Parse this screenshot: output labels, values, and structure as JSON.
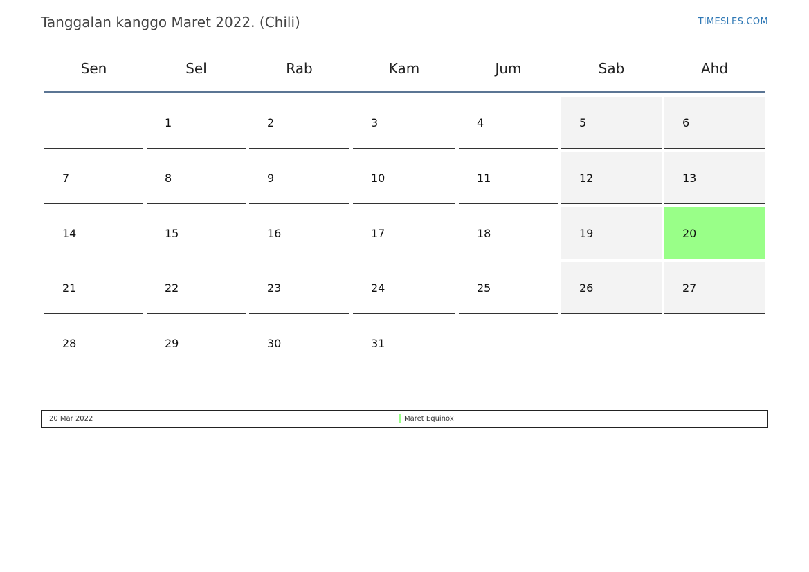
{
  "header": {
    "title": "Tanggalan kanggo Maret 2022. (Chili)",
    "site": "TIMESLES.COM"
  },
  "weekdays": [
    "Sen",
    "Sel",
    "Rab",
    "Kam",
    "Jum",
    "Sab",
    "Ahd"
  ],
  "weeks": [
    [
      "",
      "1",
      "2",
      "3",
      "4",
      "5",
      "6"
    ],
    [
      "7",
      "8",
      "9",
      "10",
      "11",
      "12",
      "13"
    ],
    [
      "14",
      "15",
      "16",
      "17",
      "18",
      "19",
      "20"
    ],
    [
      "21",
      "22",
      "23",
      "24",
      "25",
      "26",
      "27"
    ],
    [
      "28",
      "29",
      "30",
      "31",
      "",
      "",
      ""
    ]
  ],
  "holiday_day": "20",
  "colors": {
    "holiday": "#99ff88",
    "weekend": "#f3f3f3",
    "header_rule": "#5b7594",
    "link": "#2f78b5"
  },
  "legend": {
    "date": "20 Mar 2022",
    "name": "Maret Equinox"
  }
}
